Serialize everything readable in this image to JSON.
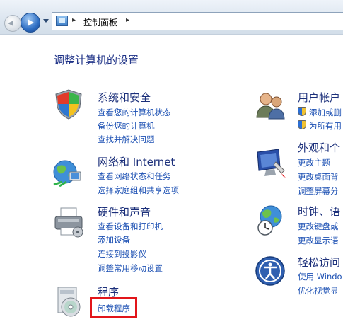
{
  "address_bar": {
    "breadcrumb": "控制面板"
  },
  "page": {
    "title": "调整计算机的设置"
  },
  "categories_left": [
    {
      "title": "系统和安全",
      "links": [
        "查看您的计算机状态",
        "备份您的计算机",
        "查找并解决问题"
      ]
    },
    {
      "title": "网络和 Internet",
      "links": [
        "查看网络状态和任务",
        "选择家庭组和共享选项"
      ]
    },
    {
      "title": "硬件和声音",
      "links": [
        "查看设备和打印机",
        "添加设备",
        "连接到投影仪",
        "调整常用移动设置"
      ]
    },
    {
      "title": "程序",
      "links": [
        "卸载程序"
      ]
    }
  ],
  "categories_right": [
    {
      "title": "用户帐户",
      "links": [
        "添加或删",
        "为所有用"
      ]
    },
    {
      "title": "外观和个",
      "links": [
        "更改主题",
        "更改桌面背",
        "调整屏幕分"
      ]
    },
    {
      "title": "时钟、语",
      "links": [
        "更改键盘或",
        "更改显示语"
      ]
    },
    {
      "title": "轻松访问",
      "links": [
        "使用 Windo",
        "优化视觉显"
      ]
    }
  ],
  "colors": {
    "title": "#1e3287",
    "link": "#1c50b3",
    "highlight": "#e2151a"
  },
  "icons": {
    "system_security": "shield-icon",
    "network": "globe-network-icon",
    "hardware_sound": "printer-icon",
    "programs": "programs-disc-icon",
    "user_accounts": "users-icon",
    "appearance": "monitor-paint-icon",
    "clock_language": "globe-clock-icon",
    "ease_of_access": "ease-of-access-icon"
  }
}
